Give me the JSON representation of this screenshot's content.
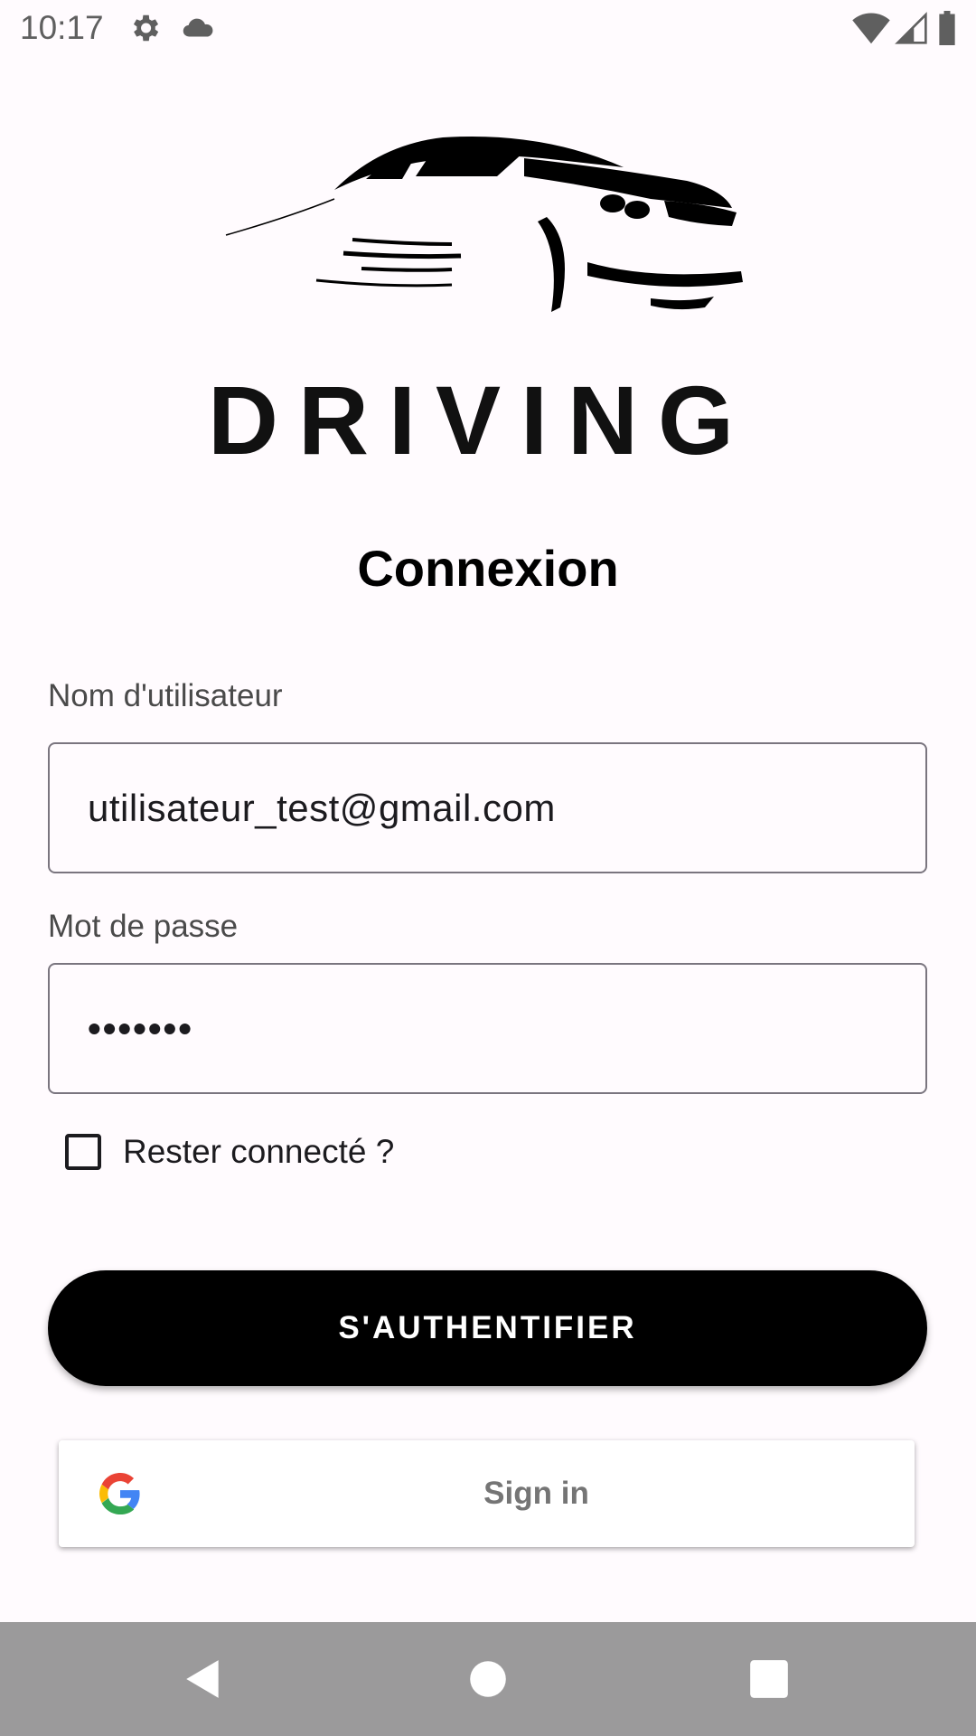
{
  "status_bar": {
    "time": "10:17",
    "left_icons": [
      "settings-icon",
      "cloud-icon"
    ],
    "right_icons": [
      "wifi-icon",
      "signal-icon",
      "battery-icon"
    ]
  },
  "logo": {
    "wordmark": "DRIVING"
  },
  "screen_title": "Connexion",
  "username": {
    "label": "Nom d'utilisateur",
    "value": "utilisateur_test@gmail.com"
  },
  "password": {
    "label": "Mot de passe",
    "value_masked": "•••••••"
  },
  "remember_me": {
    "label": "Rester connecté ?",
    "checked": false
  },
  "login_button": {
    "label": "S'AUTHENTIFIER"
  },
  "google_button": {
    "label": "Sign in",
    "icon": "google-icon"
  },
  "nav_bar": {
    "buttons": [
      "back-icon",
      "home-icon",
      "recents-icon"
    ]
  },
  "colors": {
    "primary": "#000000",
    "background": "#fffbfe",
    "nav_bar": "#9b9a9b"
  }
}
